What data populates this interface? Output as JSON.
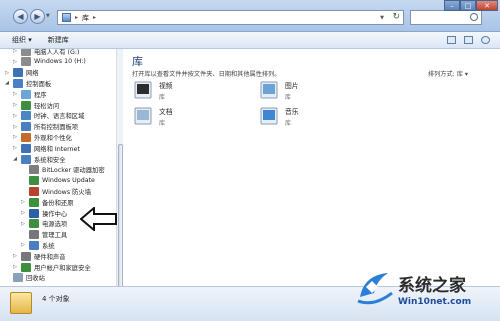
{
  "address": {
    "crumb": "库"
  },
  "toolbar": {
    "organize": "组织 ▾",
    "new_library": "新建库"
  },
  "sidebar": {
    "items": [
      {
        "label": "电脑人人有 (G:)",
        "indent": 2,
        "color": "#8c8c8c",
        "arrow": "▷"
      },
      {
        "label": "Windows 10 (H:)",
        "indent": 2,
        "color": "#8c8c8c",
        "arrow": "▷"
      },
      {
        "label": "网络",
        "indent": 1,
        "color": "#3f72b5",
        "arrow": "▷"
      },
      {
        "label": "控制面板",
        "indent": 1,
        "color": "#4a7fc1",
        "arrow": "◢"
      },
      {
        "label": "程序",
        "indent": 2,
        "color": "#6aa7d8",
        "arrow": "▷"
      },
      {
        "label": "轻松访问",
        "indent": 2,
        "color": "#3d8f3f",
        "arrow": "▷"
      },
      {
        "label": "时钟、语言和区域",
        "indent": 2,
        "color": "#4b86c2",
        "arrow": "▷"
      },
      {
        "label": "所有控制面板项",
        "indent": 2,
        "color": "#4a7fc1",
        "arrow": "▷"
      },
      {
        "label": "外观和个性化",
        "indent": 2,
        "color": "#c56b2d",
        "arrow": "▷"
      },
      {
        "label": "网络和 Internet",
        "indent": 2,
        "color": "#3f72b5",
        "arrow": "▷"
      },
      {
        "label": "系统和安全",
        "indent": 2,
        "color": "#4a7fc1",
        "arrow": "◢"
      },
      {
        "label": "BitLocker 驱动器加密",
        "indent": 3,
        "color": "#7d7d7d",
        "arrow": ""
      },
      {
        "label": "Windows Update",
        "indent": 3,
        "color": "#3b8f3f",
        "arrow": ""
      },
      {
        "label": "Windows 防火墙",
        "indent": 3,
        "color": "#b7422d",
        "arrow": ""
      },
      {
        "label": "备份和还原",
        "indent": 3,
        "color": "#3d8f3f",
        "arrow": "▷"
      },
      {
        "label": "操作中心",
        "indent": 3,
        "color": "#2c5fa8",
        "arrow": "▷"
      },
      {
        "label": "电源选项",
        "indent": 3,
        "color": "#3d8f3f",
        "arrow": "▷"
      },
      {
        "label": "管理工具",
        "indent": 3,
        "color": "#777777",
        "arrow": ""
      },
      {
        "label": "系统",
        "indent": 3,
        "color": "#4a7fc1",
        "arrow": "▷"
      },
      {
        "label": "硬件和声音",
        "indent": 2,
        "color": "#777777",
        "arrow": "▷"
      },
      {
        "label": "用户帐户和家庭安全",
        "indent": 2,
        "color": "#3d8f3f",
        "arrow": "▷"
      },
      {
        "label": "回收站",
        "indent": 1,
        "color": "#8aa0b8",
        "arrow": ""
      }
    ]
  },
  "main": {
    "title": "库",
    "description": "打开库以查看文件并按文件夹、日期和其他属性排列。",
    "arrange": "排列方式:  库 ▾",
    "libraries": [
      {
        "name": "视频",
        "sub": "库",
        "icon": "video-library-icon",
        "color": "#2d2d2d"
      },
      {
        "name": "图片",
        "sub": "库",
        "icon": "pictures-library-icon",
        "color": "#6ba3d9"
      },
      {
        "name": "文档",
        "sub": "库",
        "icon": "documents-library-icon",
        "color": "#9ab7d8"
      },
      {
        "name": "音乐",
        "sub": "库",
        "icon": "music-library-icon",
        "color": "#3f86d2"
      }
    ]
  },
  "status": {
    "text": "4 个对象"
  },
  "watermark": {
    "brand": "系统之家",
    "site": "Win10net.com"
  }
}
